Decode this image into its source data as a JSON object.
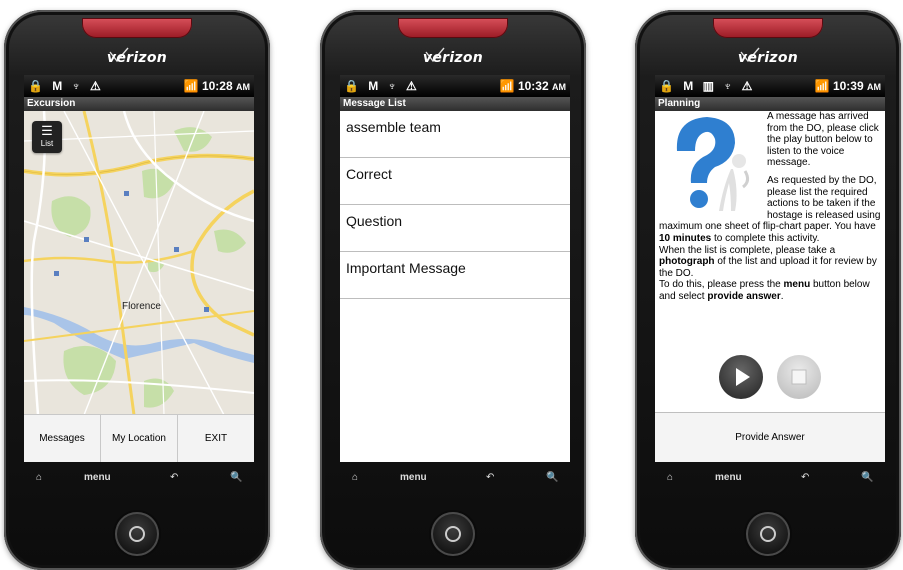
{
  "brand": "verizon",
  "phones": [
    {
      "status": {
        "left_icons": "🔒 M ♆ ⚠",
        "time": "10:28",
        "ampm": "AM"
      },
      "title": "Excursion",
      "list_button": "List",
      "map_labels": [
        "Florence"
      ],
      "bottom_buttons": [
        "Messages",
        "My Location",
        "EXIT"
      ],
      "nav": [
        "⌂",
        "menu",
        "↶",
        "🔍"
      ]
    },
    {
      "status": {
        "left_icons": "🔒 M ♆ ⚠",
        "time": "10:32",
        "ampm": "AM"
      },
      "title": "Message List",
      "messages": [
        "assemble team",
        "Correct",
        "Question",
        "Important Message"
      ],
      "nav": [
        "⌂",
        "menu",
        "↶",
        "🔍"
      ]
    },
    {
      "status": {
        "left_icons": "🔒 M ▥ ♆ ⚠",
        "time": "10:39",
        "ampm": "AM"
      },
      "title": "Planning",
      "p1": "A message has arrived from the DO, please click the play button below to listen to the voice message.",
      "p2a": "As requested by the DO, please list the required actions to be taken if the hostage is released using maximum one sheet of flip-chart paper. You have ",
      "p2b": "10 minutes",
      "p2c": " to complete this activity.",
      "p3a": "When the list is complete, please take a ",
      "p3b": "photograph",
      "p3c": " of the list and upload it for review by the DO.",
      "p4a": "To do this, please press the ",
      "p4b": "menu",
      "p4c": " button below and select ",
      "p4d": "provide answer",
      "p4e": ".",
      "provide_answer": "Provide Answer",
      "nav": [
        "⌂",
        "menu",
        "↶",
        "🔍"
      ]
    }
  ],
  "colors": {
    "speaker": "#c0303a",
    "map_land": "#e9e5dc",
    "map_water": "#a9c4e8",
    "map_park": "#c6dfa8",
    "map_road": "#f5d35e"
  }
}
